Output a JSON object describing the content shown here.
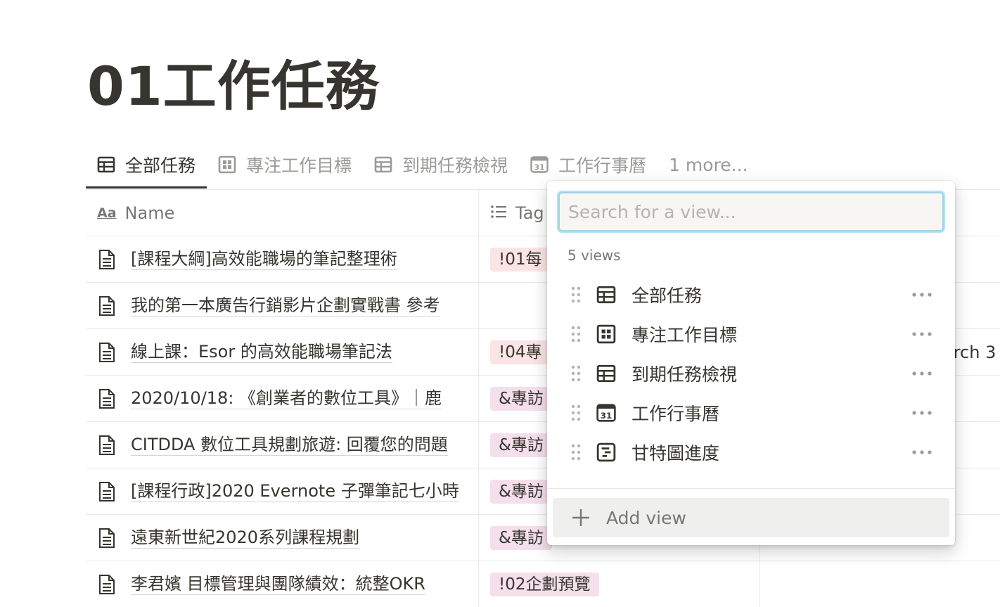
{
  "page": {
    "title": "01工作任務"
  },
  "tabs": [
    {
      "label": "全部任務",
      "icon": "table-icon",
      "active": true
    },
    {
      "label": "專注工作目標",
      "icon": "board-icon",
      "active": false
    },
    {
      "label": "到期任務檢視",
      "icon": "table-icon",
      "active": false
    },
    {
      "label": "工作行事曆",
      "icon": "calendar-icon",
      "active": false
    }
  ],
  "tabs_more": "1 more...",
  "table": {
    "columns": [
      {
        "label": "Name",
        "icon": "text-property-icon"
      },
      {
        "label": "Tag",
        "icon": "list-property-icon"
      }
    ],
    "rows": [
      {
        "name": "[課程大綱]高效能職場的筆記整理術",
        "tag": "!01每",
        "tag_color": "red",
        "date": ""
      },
      {
        "name": "我的第一本廣告行銷影片企劃實戰書 參考",
        "tag": "",
        "tag_color": "",
        "date": ""
      },
      {
        "name": "線上課：Esor 的高效能職場筆記法",
        "tag": "!04專",
        "tag_color": "red",
        "date": "arch 3"
      },
      {
        "name": "2020/10/18: 《創業者的數位工具》｜鹿",
        "tag": "&專訪",
        "tag_color": "pink",
        "date": ""
      },
      {
        "name": "CITDDA 數位工具規劃旅遊: 回覆您的問題",
        "tag": "&專訪",
        "tag_color": "pink",
        "date": ""
      },
      {
        "name": "[課程行政]2020 Evernote 子彈筆記七小時",
        "tag": "&專訪",
        "tag_color": "pink",
        "date": ""
      },
      {
        "name": "遠東新世紀2020系列課程規劃",
        "tag": "&專訪",
        "tag_color": "pink",
        "date": ""
      },
      {
        "name": "李君嬪 目標管理與團隊績效：統整OKR",
        "tag": "!02企劃預覽",
        "tag_color": "pink",
        "date": ""
      }
    ]
  },
  "view_menu": {
    "search_placeholder": "Search for a view...",
    "count_label": "5 views",
    "views": [
      {
        "label": "全部任務",
        "icon": "table-icon"
      },
      {
        "label": "專注工作目標",
        "icon": "board-icon"
      },
      {
        "label": "到期任務檢視",
        "icon": "table-icon"
      },
      {
        "label": "工作行事曆",
        "icon": "calendar-icon"
      },
      {
        "label": "甘特圖進度",
        "icon": "timeline-icon"
      }
    ],
    "add_label": "Add view",
    "calendar_icon_text": "31"
  },
  "colors": {
    "text": "#37352f",
    "muted": "#787774",
    "tag_red": "#fbe4e4",
    "tag_pink": "#f4dfeb",
    "focus_ring": "#9fd3e8"
  }
}
